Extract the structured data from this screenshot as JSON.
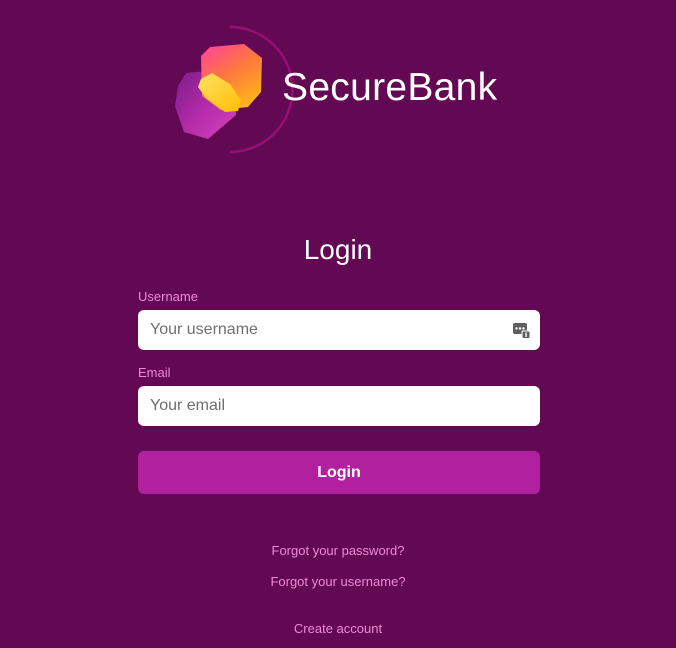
{
  "brand": {
    "name": "SecureBank",
    "logo_icon": "hexagon-logo-icon"
  },
  "form": {
    "title": "Login",
    "username": {
      "label": "Username",
      "placeholder": "Your username",
      "value": "",
      "icon": "password-manager-icon"
    },
    "email": {
      "label": "Email",
      "placeholder": "Your email",
      "value": ""
    },
    "submit_label": "Login"
  },
  "links": {
    "forgot_password": "Forgot your password?",
    "forgot_username": "Forgot your username?",
    "create_account": "Create account"
  },
  "colors": {
    "background": "#630852",
    "button": "#b1219f",
    "label": "#f08ad8",
    "text": "#ffffff"
  }
}
